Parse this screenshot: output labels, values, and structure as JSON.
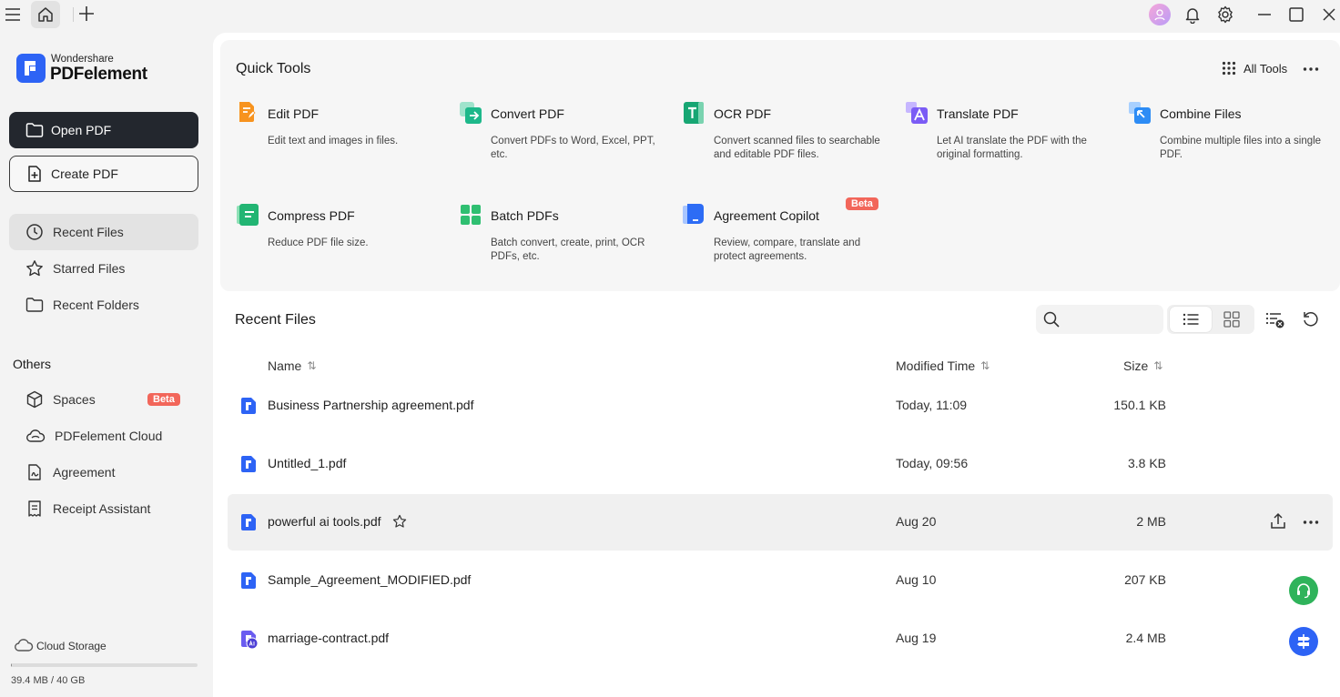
{
  "colors": {
    "accent": "#2d63f5",
    "dark_button": "#23272e",
    "badge": "#f2665a",
    "support": "#2fb35b"
  },
  "titlebar": {
    "icons": [
      "menu-icon",
      "home-icon",
      "plus-icon",
      "avatar",
      "bell-icon",
      "gear-icon",
      "minimize-icon",
      "maximize-icon",
      "close-icon"
    ]
  },
  "brand": {
    "small": "Wondershare",
    "big": "PDFelement"
  },
  "sidebar": {
    "open_pdf": "Open PDF",
    "create_pdf": "Create PDF",
    "nav": [
      {
        "label": "Recent Files",
        "icon": "clock-icon",
        "active": true
      },
      {
        "label": "Starred Files",
        "icon": "star-icon"
      },
      {
        "label": "Recent Folders",
        "icon": "folder-icon"
      }
    ],
    "others_label": "Others",
    "others": [
      {
        "label": "Spaces",
        "icon": "cube-icon",
        "badge": "Beta"
      },
      {
        "label": "PDFelement Cloud",
        "icon": "cloud-icon"
      },
      {
        "label": "Agreement",
        "icon": "agreement-icon"
      },
      {
        "label": "Receipt Assistant",
        "icon": "receipt-icon"
      }
    ],
    "storage": {
      "label": "Cloud Storage",
      "value": "39.4 MB / 40 GB",
      "fraction": 0.001
    }
  },
  "quick_tools": {
    "title": "Quick Tools",
    "all_tools": "All Tools",
    "tools": [
      {
        "name": "Edit PDF",
        "desc": "Edit text and images in files.",
        "color": "#f7931e"
      },
      {
        "name": "Convert PDF",
        "desc": "Convert PDFs to Word, Excel, PPT, etc.",
        "color": "#1db88a"
      },
      {
        "name": "OCR PDF",
        "desc": "Convert scanned files to searchable and editable PDF files.",
        "color": "#17a673"
      },
      {
        "name": "Translate PDF",
        "desc": "Let AI translate the PDF with the original formatting.",
        "color": "#7b5cf5"
      },
      {
        "name": "Combine Files",
        "desc": "Combine multiple files into a single PDF.",
        "color": "#2d8cf5"
      },
      {
        "name": "Compress PDF",
        "desc": "Reduce PDF file size.",
        "color": "#22b573"
      },
      {
        "name": "Batch PDFs",
        "desc": "Batch convert, create, print, OCR PDFs, etc.",
        "color": "#2fbf71"
      },
      {
        "name": "Agreement Copilot",
        "desc": "Review, compare, translate and protect agreements.",
        "color": "#2d6cf5",
        "badge": "Beta"
      }
    ]
  },
  "recent": {
    "title": "Recent Files",
    "columns": {
      "name": "Name",
      "modified": "Modified Time",
      "size": "Size"
    },
    "files": [
      {
        "name": "Business Partnership agreement.pdf",
        "modified": "Today, 11:09",
        "size": "150.1 KB",
        "type": "pdf"
      },
      {
        "name": "Untitled_1.pdf",
        "modified": "Today, 09:56",
        "size": "3.8 KB",
        "type": "pdf"
      },
      {
        "name": "powerful ai tools.pdf",
        "modified": "Aug 20",
        "size": "2 MB",
        "type": "pdf",
        "hover": true
      },
      {
        "name": "Sample_Agreement_MODIFIED.pdf",
        "modified": "Aug 10",
        "size": "207 KB",
        "type": "pdf"
      },
      {
        "name": "marriage-contract.pdf",
        "modified": "Aug 19",
        "size": "2.4 MB",
        "type": "ai-pdf"
      }
    ]
  }
}
